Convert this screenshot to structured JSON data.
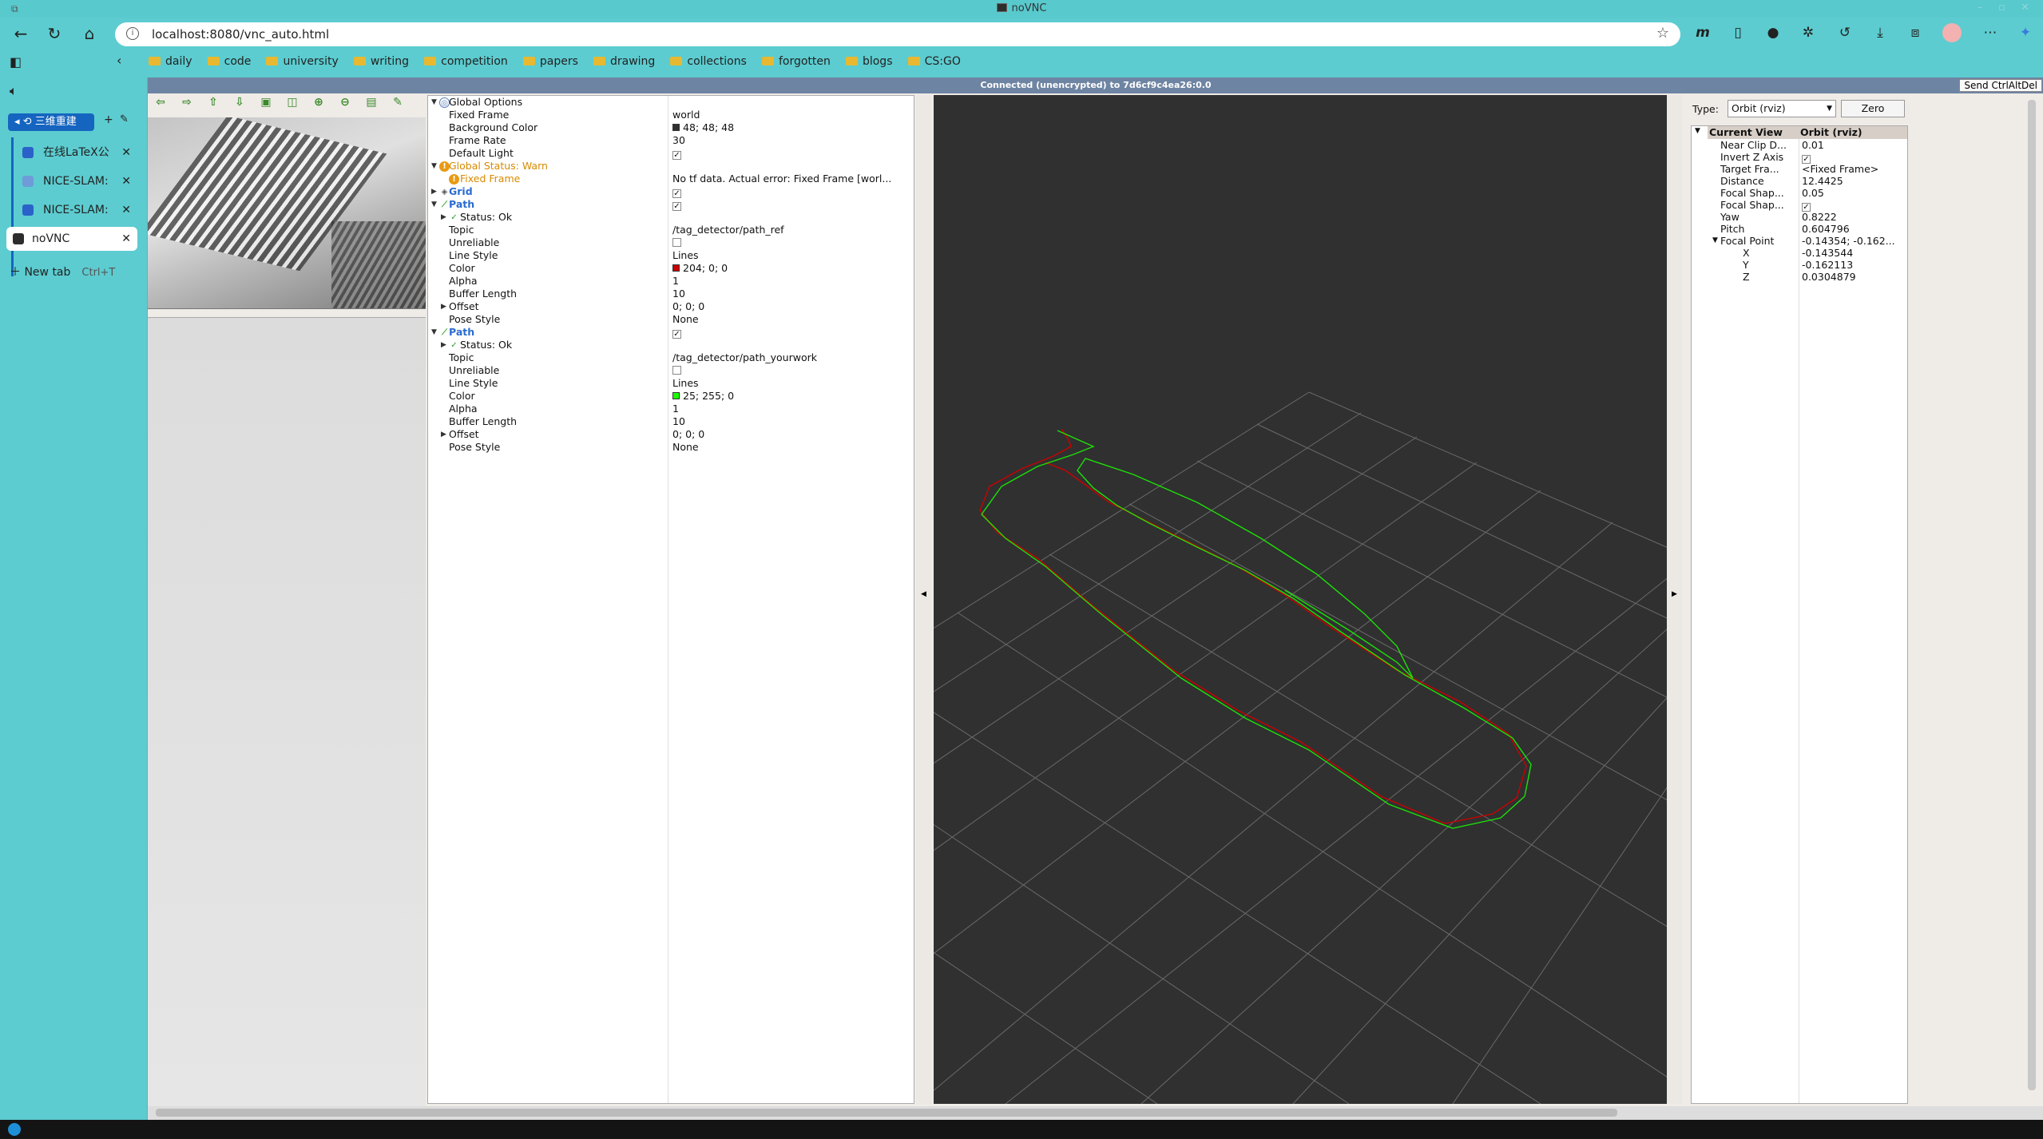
{
  "window": {
    "title": "noVNC"
  },
  "browser": {
    "url": "localhost:8080/vnc_auto.html",
    "bookmarks": [
      "daily",
      "code",
      "university",
      "writing",
      "competition",
      "papers",
      "drawing",
      "collections",
      "forgotten",
      "blogs",
      "CS:GO"
    ]
  },
  "sidebar": {
    "group_label": "三维重建",
    "tabs": [
      {
        "label": "在线LaTeX公",
        "favicon_color": "#2a62c9"
      },
      {
        "label": "NICE-SLAM:",
        "favicon_color": "#6f9bd8"
      },
      {
        "label": "NICE-SLAM:",
        "favicon_color": "#2a62c9"
      }
    ],
    "active_tab": "noVNC",
    "new_tab_label": "New tab",
    "new_tab_shortcut": "Ctrl+T"
  },
  "vnc": {
    "status": "Connected (unencrypted) to 7d6cf9c4ea26:0.0",
    "send_cad": "Send CtrlAltDel"
  },
  "displays": {
    "global_options": "Global Options",
    "fixed_frame": {
      "name": "Fixed Frame",
      "value": "world"
    },
    "background_color": {
      "name": "Background Color",
      "value": "48; 48; 48",
      "swatch": "#303030"
    },
    "frame_rate": {
      "name": "Frame Rate",
      "value": "30"
    },
    "default_light": {
      "name": "Default Light"
    },
    "global_status": "Global Status: Warn",
    "fixed_frame_warn": {
      "name": "Fixed Frame",
      "value": "No tf data.  Actual error: Fixed Frame [worl..."
    },
    "grid": "Grid",
    "path1": {
      "title": "Path",
      "status": "Status: Ok",
      "topic": {
        "name": "Topic",
        "value": "/tag_detector/path_ref"
      },
      "unreliable": "Unreliable",
      "line_style": {
        "name": "Line Style",
        "value": "Lines"
      },
      "color": {
        "name": "Color",
        "value": "204; 0; 0",
        "swatch": "#cc0000"
      },
      "alpha": {
        "name": "Alpha",
        "value": "1"
      },
      "buffer_length": {
        "name": "Buffer Length",
        "value": "10"
      },
      "offset": {
        "name": "Offset",
        "value": "0; 0; 0"
      },
      "pose_style": {
        "name": "Pose Style",
        "value": "None"
      }
    },
    "path2": {
      "title": "Path",
      "status": "Status: Ok",
      "topic": {
        "name": "Topic",
        "value": "/tag_detector/path_yourwork"
      },
      "unreliable": "Unreliable",
      "line_style": {
        "name": "Line Style",
        "value": "Lines"
      },
      "color": {
        "name": "Color",
        "value": "25; 255; 0",
        "swatch": "#19ff00"
      },
      "alpha": {
        "name": "Alpha",
        "value": "1"
      },
      "buffer_length": {
        "name": "Buffer Length",
        "value": "10"
      },
      "offset": {
        "name": "Offset",
        "value": "0; 0; 0"
      },
      "pose_style": {
        "name": "Pose Style",
        "value": "None"
      }
    }
  },
  "views": {
    "type_label": "Type:",
    "type_value": "Orbit (rviz)",
    "zero": "Zero",
    "current_view": "Current View",
    "current_view_value": "Orbit (rviz)",
    "near_clip": {
      "name": "Near Clip D...",
      "value": "0.01"
    },
    "invert_z": {
      "name": "Invert Z Axis"
    },
    "target_frame": {
      "name": "Target Fra...",
      "value": "<Fixed Frame>"
    },
    "distance": {
      "name": "Distance",
      "value": "12.4425"
    },
    "focal_shape_size": {
      "name": "Focal Shap...",
      "value": "0.05"
    },
    "focal_shape_fixed": {
      "name": "Focal Shap..."
    },
    "yaw": {
      "name": "Yaw",
      "value": "0.8222"
    },
    "pitch": {
      "name": "Pitch",
      "value": "0.604796"
    },
    "focal_point": {
      "name": "Focal Point",
      "value": "-0.14354; -0.162..."
    },
    "x": {
      "name": "X",
      "value": "-0.143544"
    },
    "y": {
      "name": "Y",
      "value": "-0.162113"
    },
    "z": {
      "name": "Z",
      "value": "0.0304879"
    }
  }
}
